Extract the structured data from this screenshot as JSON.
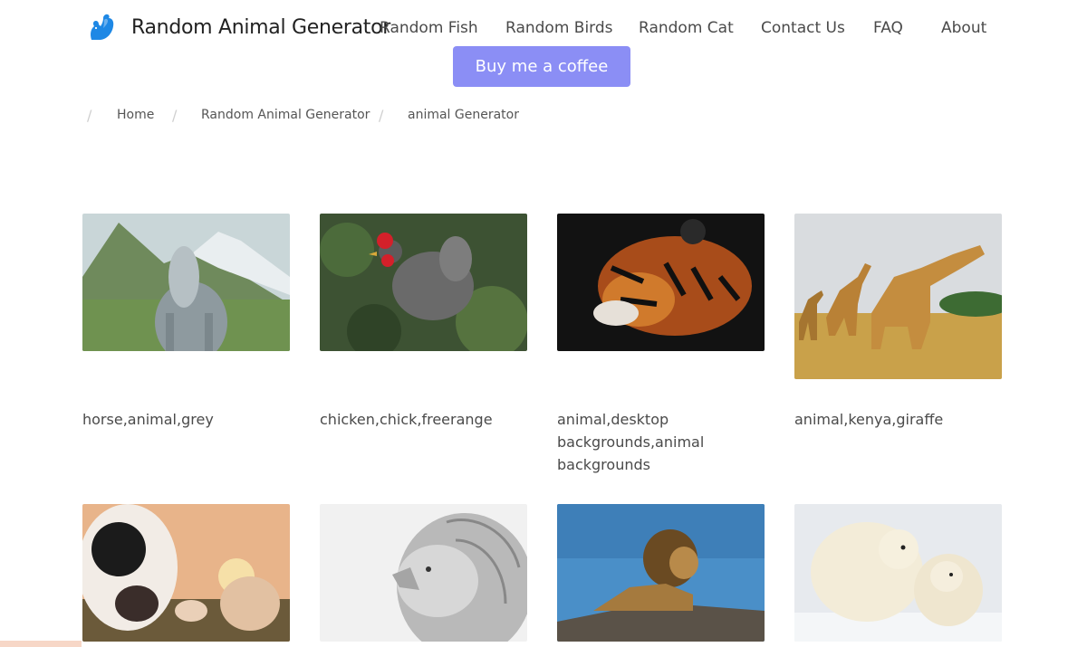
{
  "header": {
    "brand": "Random Animal Generator",
    "logo_icon": "squirrel-icon",
    "nav": [
      {
        "label": "Random Fish"
      },
      {
        "label": "Random Birds"
      },
      {
        "label": "Random Cat"
      },
      {
        "label": "Contact Us"
      },
      {
        "label": "FAQ"
      },
      {
        "label": "About"
      }
    ],
    "coffee_button": "Buy me a coffee"
  },
  "breadcrumb": {
    "separator": "/",
    "items": [
      {
        "label": "Home"
      },
      {
        "label": "Random Animal Generator"
      },
      {
        "label": "animal Generator"
      }
    ]
  },
  "gallery": {
    "cards": [
      {
        "caption": "horse,animal,grey",
        "image": "horse-photo"
      },
      {
        "caption": "chicken,chick,freerange",
        "image": "chicken-photo"
      },
      {
        "caption": "animal,desktop backgrounds,animal backgrounds",
        "image": "tiger-photo"
      },
      {
        "caption": "animal,kenya,giraffe",
        "image": "giraffe-photo"
      },
      {
        "caption": "",
        "image": "cow-photo"
      },
      {
        "caption": "",
        "image": "lion-bw-photo"
      },
      {
        "caption": "",
        "image": "lion-rock-photo"
      },
      {
        "caption": "",
        "image": "polar-bear-photo"
      }
    ]
  },
  "colors": {
    "accent": "#8b8ef5",
    "logo": "#1e88e5"
  }
}
